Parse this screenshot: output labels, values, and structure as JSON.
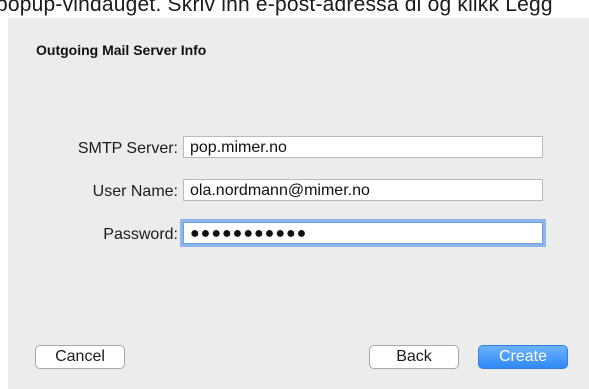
{
  "background_text": "popup-vindauget. Skriv inn e-post-adressa di og klikk Legg",
  "dialog": {
    "heading": "Outgoing Mail Server Info",
    "fields": [
      {
        "label": "SMTP Server:",
        "value": "pop.mimer.no",
        "type": "text",
        "focused": false
      },
      {
        "label": "User Name:",
        "value": "ola.nordmann@mimer.no",
        "type": "text",
        "focused": false
      },
      {
        "label": "Password:",
        "value": "●●●●●●●●●●●",
        "type": "password",
        "focused": true
      }
    ],
    "buttons": {
      "cancel": "Cancel",
      "back": "Back",
      "create": "Create"
    }
  },
  "colors": {
    "dialog_bg": "#ececec",
    "accent": "#2f89f7",
    "focus_ring": "#8fb6ec"
  }
}
